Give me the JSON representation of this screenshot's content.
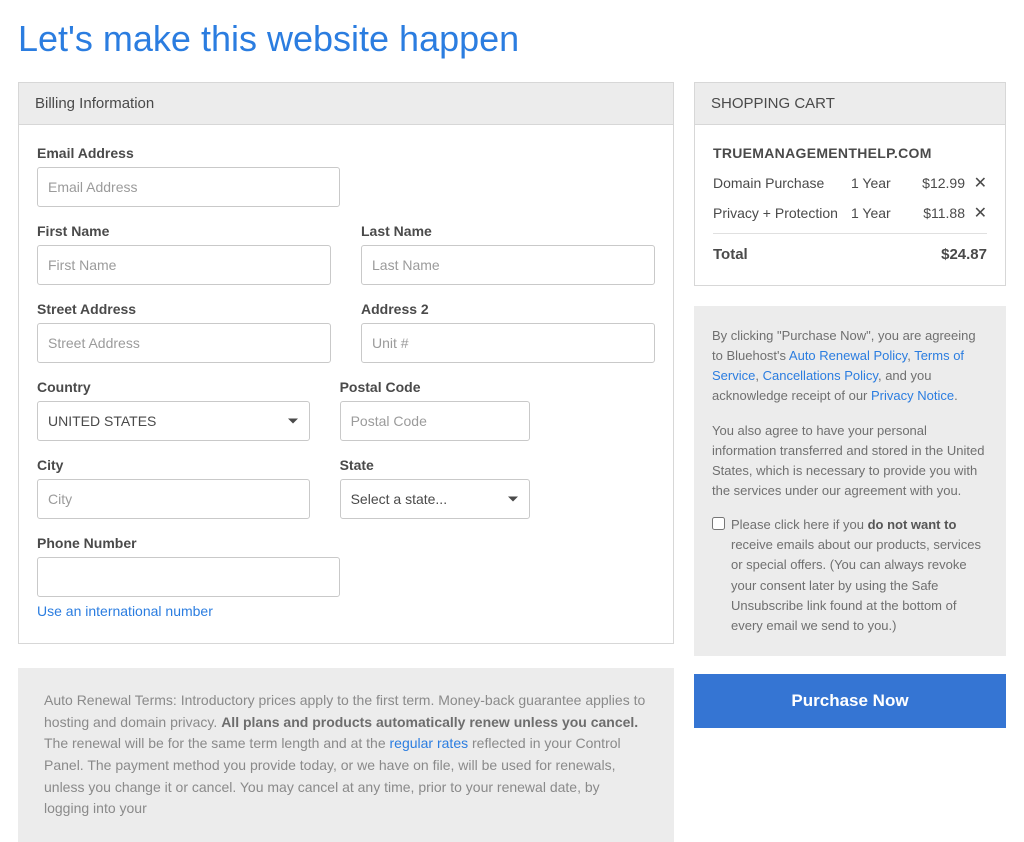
{
  "title": "Let's make this website happen",
  "billing": {
    "heading": "Billing Information",
    "email_label": "Email Address",
    "email_placeholder": "Email Address",
    "first_name_label": "First Name",
    "first_name_placeholder": "First Name",
    "last_name_label": "Last Name",
    "last_name_placeholder": "Last Name",
    "street_label": "Street Address",
    "street_placeholder": "Street Address",
    "address2_label": "Address 2",
    "address2_placeholder": "Unit #",
    "country_label": "Country",
    "country_value": "UNITED STATES",
    "postal_label": "Postal Code",
    "postal_placeholder": "Postal Code",
    "city_label": "City",
    "city_placeholder": "City",
    "state_label": "State",
    "state_value": "Select a state...",
    "phone_label": "Phone Number",
    "intl_link": "Use an international number"
  },
  "cart": {
    "heading": "SHOPPING CART",
    "domain": "TRUEMANAGEMENTHELP.COM",
    "items": [
      {
        "label": "Domain Purchase",
        "term": "1 Year",
        "price": "$12.99"
      },
      {
        "label": "Privacy + Protection",
        "term": "1 Year",
        "price": "$11.88"
      }
    ],
    "total_label": "Total",
    "total_value": "$24.87"
  },
  "agree": {
    "prefix": "By clicking \"Purchase Now\", you are agreeing to Bluehost's ",
    "auto_renewal": "Auto Renewal Policy",
    "tos": "Terms of Service",
    "cancel": "Cancellations Policy",
    "mid": ", and you acknowledge receipt of our ",
    "privacy": "Privacy Notice",
    "transfer": "You also agree to have your personal information transferred and stored in the United States, which is necessary to provide you with the services under our agreement with you.",
    "optout_prefix": "Please click here if you ",
    "optout_bold": "do not want to",
    "optout_suffix": " receive emails about our products, services or special offers. (You can always revoke your consent later by using the Safe Unsubscribe link found at the bottom of every email we send to you.)"
  },
  "purchase_button": "Purchase Now",
  "renewal": {
    "lead": "Auto Renewal Terms: Introductory prices apply to the first term. Money-back guarantee applies to hosting and domain privacy. ",
    "bold": "All plans and products automatically renew unless you cancel.",
    "mid1": " The renewal will be for the same term length and at the ",
    "regular": "regular rates",
    "tail": " reflected in your Control Panel. The payment method you provide today, or we have on file, will be used for renewals, unless you change it or cancel. You may cancel at any time, prior to your renewal date, by logging into your"
  }
}
